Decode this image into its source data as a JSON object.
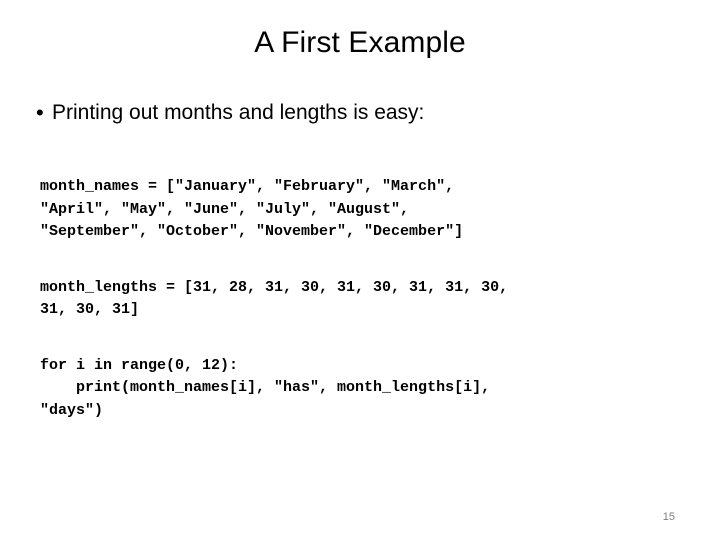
{
  "slide": {
    "title": "A First Example",
    "bullet": {
      "marker": "•",
      "text": "Printing out months and lengths is easy:"
    },
    "code_blocks": [
      {
        "id": "month-names-block",
        "text": "month_names = [\"January\", \"February\", \"March\",\n\"April\", \"May\", \"June\", \"July\", \"August\",\n\"September\", \"October\", \"November\", \"December\"]"
      },
      {
        "id": "month-lengths-block",
        "text": "month_lengths = [31, 28, 31, 30, 31, 30, 31, 31, 30,\n31, 30, 31]"
      },
      {
        "id": "for-loop-block",
        "text": "for i in range(0, 12):\n    print(month_names[i], \"has\", month_lengths[i],\n\"days\")"
      }
    ],
    "page_number": "15"
  }
}
